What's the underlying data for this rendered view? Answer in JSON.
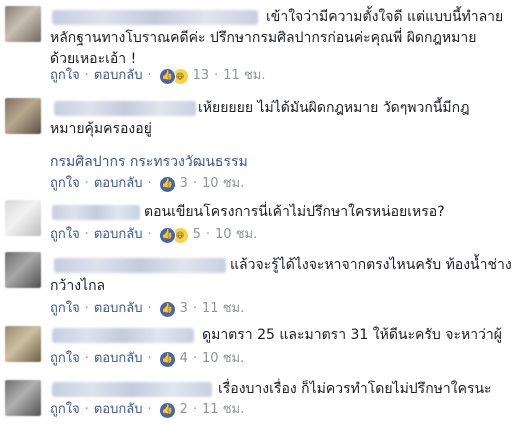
{
  "actions": {
    "like": "ถูกใจ",
    "reply": "ตอบกลับ",
    "separator": "·"
  },
  "comments": [
    {
      "lines": [
        "เข้าใจว่ามีความตั้งใจดี แต่แบบนี้ทำลาย",
        "หลักฐานทางโบราณคดีค่ะ ปรึกษากรมศิลปากรก่อนค่ะคุณพี่ ผิดกฎหมาย",
        "ด้วยเหอะเอ้า !"
      ],
      "reactions": [
        "like",
        "haha"
      ],
      "count": "13",
      "time": "11 ชม."
    },
    {
      "lines": [
        "เห้ยยยยย ไม่ได้มันผิดกฎหมาย วัดๆพวกนี้มีกฎ",
        "หมายคุ้มครองอยู่"
      ],
      "link": "กรมศิลปากร กระทรวงวัฒนธรรม",
      "reactions": [
        "like"
      ],
      "count": "3",
      "time": "10 ชม."
    },
    {
      "lines": [
        "ตอนเขียนโครงการนี่เค้าไม่ปรึกษาใครหน่อยเหรอ?"
      ],
      "reactions": [
        "like",
        "haha"
      ],
      "count": "5",
      "time": "10 ชม."
    },
    {
      "lines": [
        "แล้วจะรู้ได้ไงจะหาจากตรงไหนครับ ท้องน้ำช่าง",
        "กว้างไกล"
      ],
      "reactions": [
        "like"
      ],
      "count": "3",
      "time": "11 ชม."
    },
    {
      "lines": [
        "ดูมาตรา 25 และมาตรา 31 ให้ดีนะครับ จะหาว่าผู้"
      ],
      "reactions": [
        "like"
      ],
      "count": "4",
      "time": "10 ชม."
    },
    {
      "lines": [
        "เรื่องบางเรื่อง ก็ไม่ควรทำโดยไม่ปรึกษาใครนะ"
      ],
      "reactions": [
        "like"
      ],
      "count": "2",
      "time": "11 ชม."
    }
  ]
}
